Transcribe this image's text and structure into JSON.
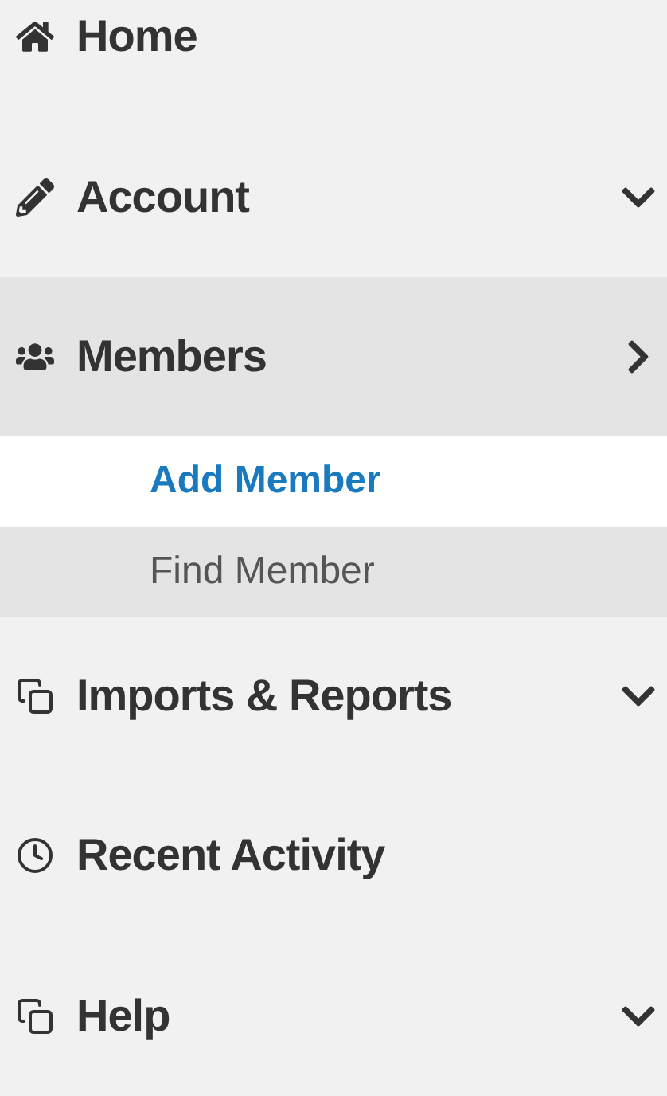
{
  "menu": [
    {
      "label": "Home",
      "kind": "link",
      "selected": false
    },
    {
      "label": "Account",
      "kind": "group",
      "selected": false,
      "expanded": false
    },
    {
      "label": "Members",
      "kind": "group",
      "selected": true,
      "expanded": true,
      "children": [
        {
          "label": "Add Member",
          "selected": true
        },
        {
          "label": "Find Member",
          "selected": false
        }
      ]
    },
    {
      "label": "Imports & Reports",
      "kind": "group",
      "selected": false,
      "expanded": false
    },
    {
      "label": "Recent Activity",
      "kind": "link",
      "selected": false
    },
    {
      "label": "Help",
      "kind": "group",
      "selected": false,
      "expanded": false
    }
  ]
}
